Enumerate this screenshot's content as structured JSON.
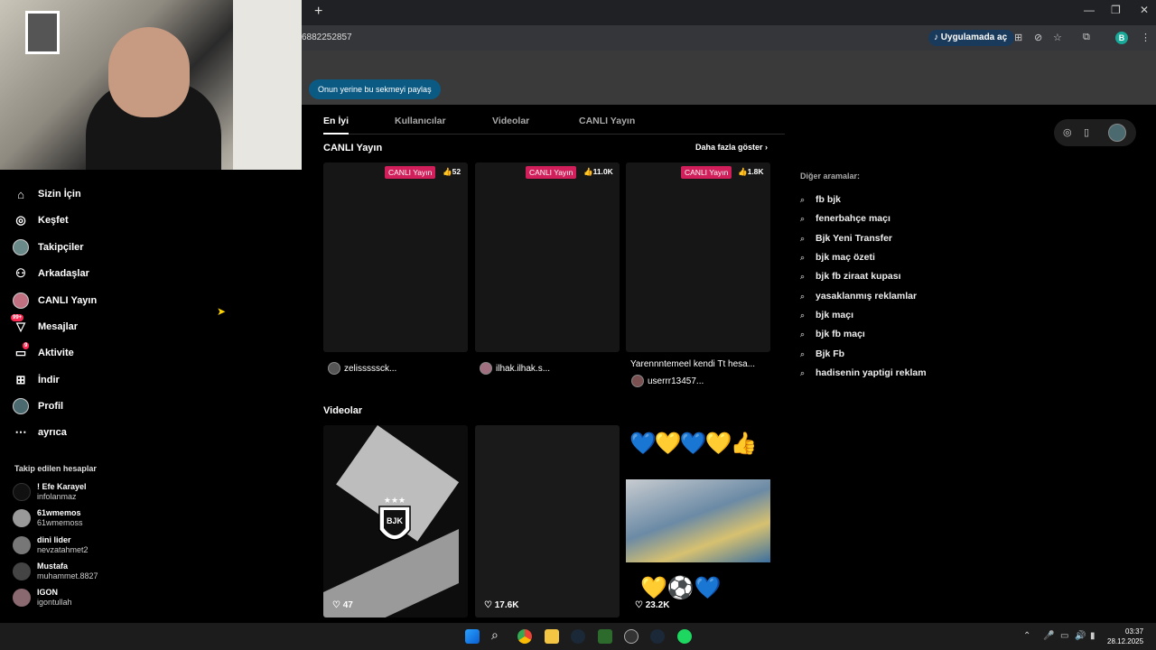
{
  "browser": {
    "url": "6882252857",
    "open_app_label": "Uygulamada aç",
    "profile_initial": "B",
    "share_button": "Onun yerine bu sekmeyi paylaş"
  },
  "sidebar": {
    "items": [
      {
        "label": "Sizin İçin",
        "icon": "home-icon"
      },
      {
        "label": "Keşfet",
        "icon": "compass-icon"
      },
      {
        "label": "Takipçiler",
        "icon": "avatar-icon"
      },
      {
        "label": "Arkadaşlar",
        "icon": "people-icon"
      },
      {
        "label": "CANLI Yayın",
        "icon": "live-icon"
      },
      {
        "label": "Mesajlar",
        "icon": "message-icon",
        "badge": "99+"
      },
      {
        "label": "Aktivite",
        "icon": "activity-icon",
        "badge": "9"
      },
      {
        "label": "İndir",
        "icon": "download-icon"
      },
      {
        "label": "Profil",
        "icon": "profile-icon"
      },
      {
        "label": "ayrıca",
        "icon": "more-icon"
      }
    ],
    "following_title": "Takip edilen hesaplar",
    "following": [
      {
        "name": "! Efe Karayel",
        "user": "infolanmaz"
      },
      {
        "name": "61wmemos",
        "user": "61wmemoss"
      },
      {
        "name": "dini lider",
        "user": "nevzatahmet2"
      },
      {
        "name": "Mustafa",
        "user": "muhammet.8827"
      },
      {
        "name": "IGON",
        "user": "igontullah"
      }
    ]
  },
  "tabs": [
    "En İyi",
    "Kullanıcılar",
    "Videolar",
    "CANLI Yayın"
  ],
  "live_section": {
    "title": "CANLI Yayın",
    "more": "Daha fazla göster",
    "cards": [
      {
        "tag": "CANLI Yayın",
        "likes": "52",
        "user": "zelisssssck..."
      },
      {
        "tag": "CANLI Yayın",
        "likes": "11.0K",
        "user": "ilhak.ilhak.s..."
      },
      {
        "tag": "CANLI Yayın",
        "likes": "1.8K",
        "title": "Yarennntemeel kendi Tt hesa...",
        "user": "userrr13457..."
      }
    ]
  },
  "video_section": {
    "title": "Videolar",
    "cards": [
      {
        "likes": "47"
      },
      {
        "likes": "17.6K"
      },
      {
        "likes": "23.2K"
      }
    ]
  },
  "other_searches": {
    "title": "Diğer aramalar:",
    "items": [
      "fb bjk",
      "fenerbahçe maçı",
      "Bjk Yeni Transfer",
      "bjk maç özeti",
      "bjk fb ziraat kupası",
      "yasaklanmış reklamlar",
      "bjk maçı",
      "bjk fb maçı",
      "Bjk Fb",
      "hadisenin yaptigi reklam"
    ]
  },
  "taskbar": {
    "time": "03:37",
    "date": "28.12.2025"
  }
}
